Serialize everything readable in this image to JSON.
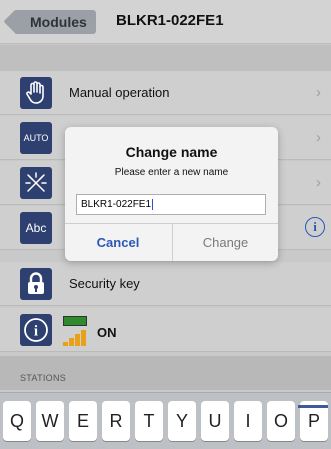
{
  "navbar": {
    "back_label": "Modules",
    "title": "BLKR1-022FE1"
  },
  "menu": {
    "manual_operation": "Manual operation",
    "auto_icon_text": "AUTO",
    "abc_icon_text": "Abc",
    "security_key": "Security key",
    "status_text": "ON"
  },
  "section": {
    "stations": "STATIONS"
  },
  "dialog": {
    "title": "Change name",
    "message": "Please enter a new name",
    "input_value": "BLKR1-022FE1",
    "cancel_label": "Cancel",
    "change_label": "Change"
  },
  "keyboard": {
    "keys": [
      "Q",
      "W",
      "E",
      "R",
      "T",
      "Y",
      "U",
      "I",
      "O",
      "P"
    ]
  },
  "colors": {
    "accent": "#2b58b8",
    "icon_bg": "#2e4070",
    "battery": "#2d8a2d",
    "signal": "#e8a21a"
  }
}
